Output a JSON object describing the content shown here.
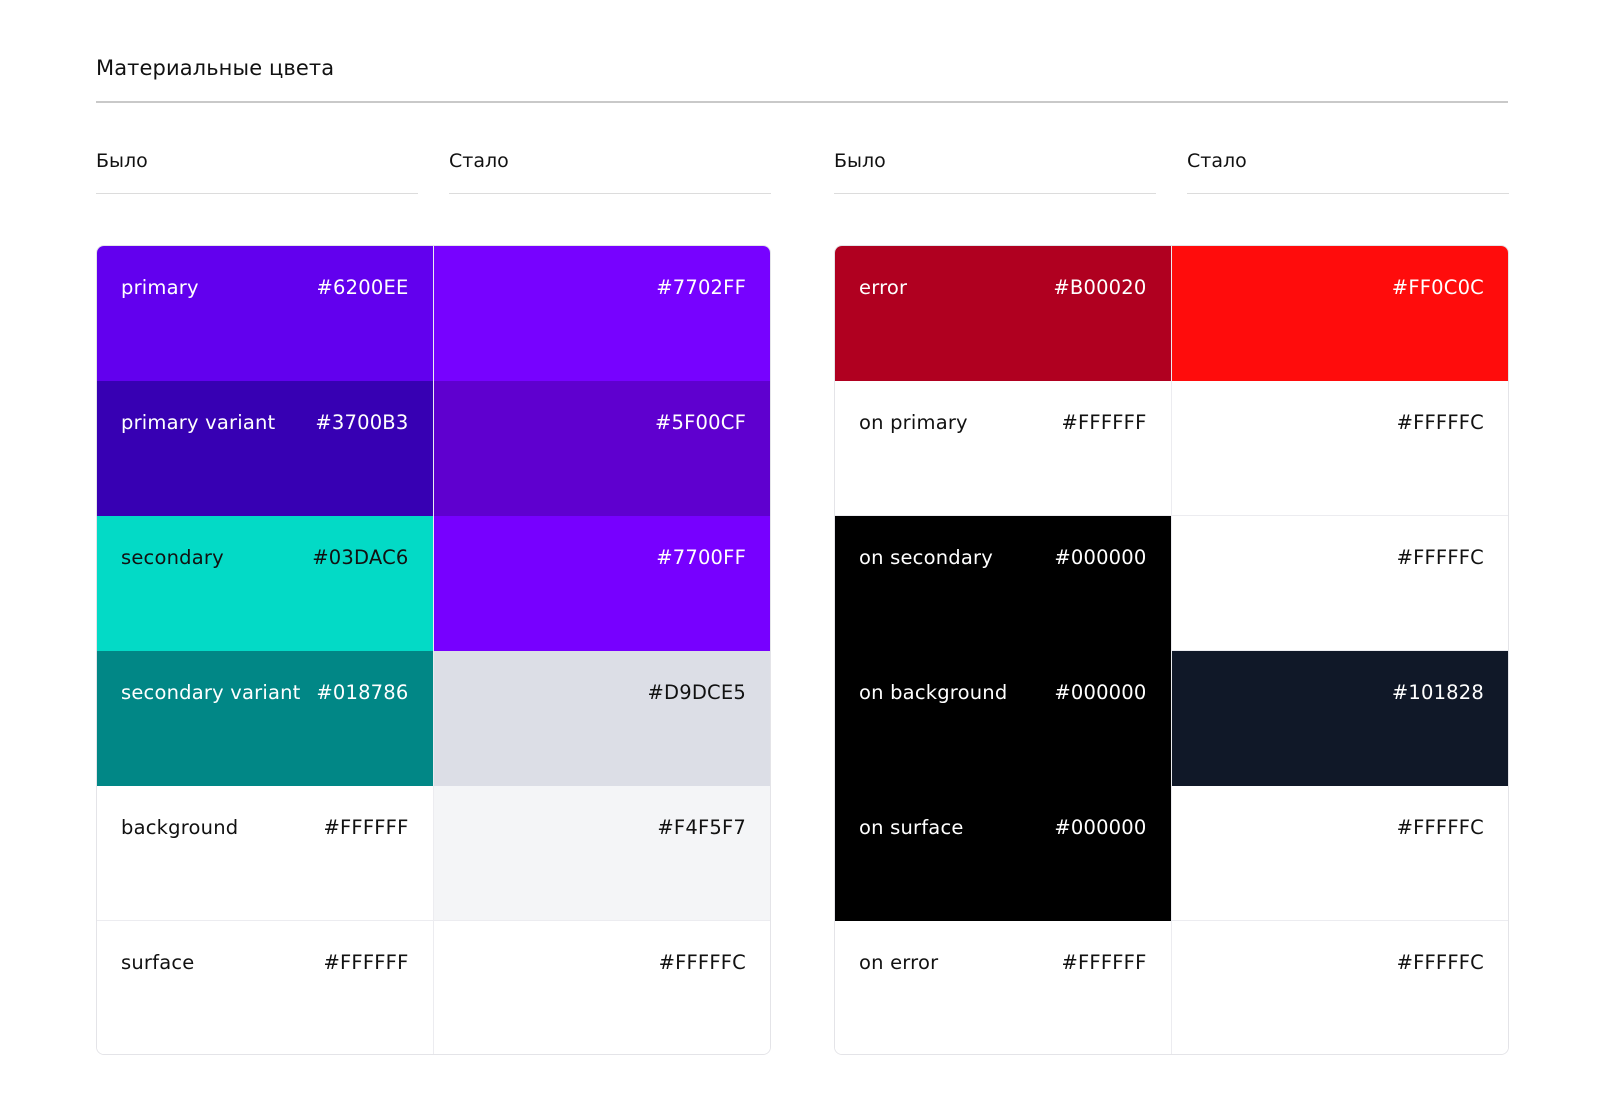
{
  "title": "Материальные цвета",
  "headers": {
    "left_old": "Было",
    "left_new": "Стало",
    "right_old": "Было",
    "right_new": "Стало"
  },
  "left_palette": [
    {
      "name": "primary",
      "old_hex": "#6200EE",
      "new_hex": "#7702FF",
      "old_color": "#6200EE",
      "new_color": "#7702FF",
      "old_text": "#ffffff",
      "new_text": "#ffffff"
    },
    {
      "name": "primary variant",
      "old_hex": "#3700B3",
      "new_hex": "#5F00CF",
      "old_color": "#3700B3",
      "new_color": "#5F00CF",
      "old_text": "#ffffff",
      "new_text": "#ffffff"
    },
    {
      "name": "secondary",
      "old_hex": "#03DAC6",
      "new_hex": "#7700FF",
      "old_color": "#03DAC6",
      "new_color": "#7700FF",
      "old_text": "#111111",
      "new_text": "#ffffff"
    },
    {
      "name": "secondary variant",
      "old_hex": "#018786",
      "new_hex": "#D9DCE5",
      "old_color": "#018786",
      "new_color": "#DCDEE6",
      "old_text": "#ffffff",
      "new_text": "#111111"
    },
    {
      "name": "background",
      "old_hex": "#FFFFFF",
      "new_hex": "#F4F5F7",
      "old_color": "#FFFFFF",
      "new_color": "#F4F5F7",
      "old_text": "#111111",
      "new_text": "#111111"
    },
    {
      "name": "surface",
      "old_hex": "#FFFFFF",
      "new_hex": "#FFFFFC",
      "old_color": "#FFFFFF",
      "new_color": "#FFFFFF",
      "old_text": "#111111",
      "new_text": "#111111"
    }
  ],
  "right_palette": [
    {
      "name": "error",
      "old_hex": "#B00020",
      "new_hex": "#FF0C0C",
      "old_color": "#B00020",
      "new_color": "#FF0C0C",
      "old_text": "#ffffff",
      "new_text": "#ffffff"
    },
    {
      "name": "on primary",
      "old_hex": "#FFFFFF",
      "new_hex": "#FFFFFC",
      "old_color": "#FFFFFF",
      "new_color": "#FFFFFF",
      "old_text": "#111111",
      "new_text": "#111111"
    },
    {
      "name": "on secondary",
      "old_hex": "#000000",
      "new_hex": "#FFFFFC",
      "old_color": "#000000",
      "new_color": "#FFFFFF",
      "old_text": "#ffffff",
      "new_text": "#111111"
    },
    {
      "name": "on background",
      "old_hex": "#000000",
      "new_hex": "#101828",
      "old_color": "#000000",
      "new_color": "#101828",
      "old_text": "#ffffff",
      "new_text": "#ffffff"
    },
    {
      "name": "on surface",
      "old_hex": "#000000",
      "new_hex": "#FFFFFC",
      "old_color": "#000000",
      "new_color": "#FFFFFF",
      "old_text": "#ffffff",
      "new_text": "#111111"
    },
    {
      "name": "on error",
      "old_hex": "#FFFFFF",
      "new_hex": "#FFFFFC",
      "old_color": "#FFFFFF",
      "new_color": "#FFFFFF",
      "old_text": "#111111",
      "new_text": "#111111"
    }
  ]
}
